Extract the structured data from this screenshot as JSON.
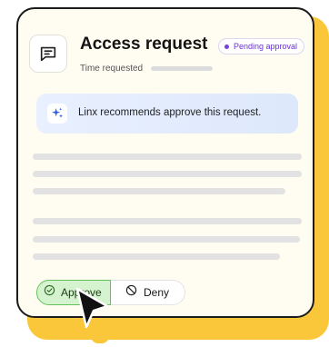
{
  "card": {
    "title": "Access request",
    "status_badge": "Pending approval",
    "time_label": "Time requested",
    "icon": "message-icon"
  },
  "recommendation": {
    "text": "Linx recommends approve this request.",
    "icon": "sparkle-icon"
  },
  "actions": {
    "approve_label": "Approve",
    "approve_icon": "check-circle-icon",
    "deny_label": "Deny",
    "deny_icon": "block-icon"
  },
  "colors": {
    "accent_shadow": "#fbc73a",
    "badge_purple": "#7a3fe0",
    "approve_green": "#63c25a",
    "reco_blue": "#e2ebfd"
  }
}
